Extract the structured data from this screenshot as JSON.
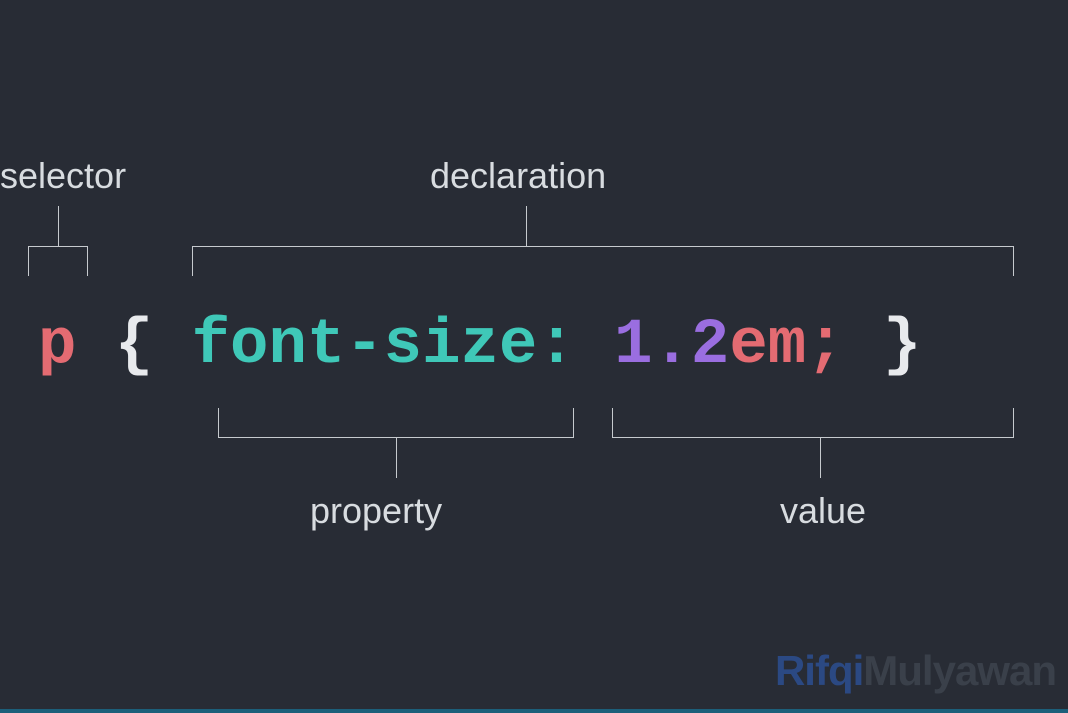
{
  "labels": {
    "selector": "selector",
    "declaration": "declaration",
    "property": "property",
    "value": "value"
  },
  "code": {
    "selector": "p",
    "brace_open": "{",
    "property": "font-size",
    "colon": ":",
    "value_number": "1.2",
    "value_unit": "em",
    "semicolon": ";",
    "brace_close": "}"
  },
  "colors": {
    "selector": "#e46b72",
    "brace": "#e8eaed",
    "property": "#3fc8b8",
    "colon": "#3fc8b8",
    "value_number": "#9a6ee0",
    "value_unit": "#e46b72",
    "semicolon": "#e46b72"
  },
  "watermark": {
    "part1": "Rifqi",
    "part2": "Mulyawan"
  }
}
